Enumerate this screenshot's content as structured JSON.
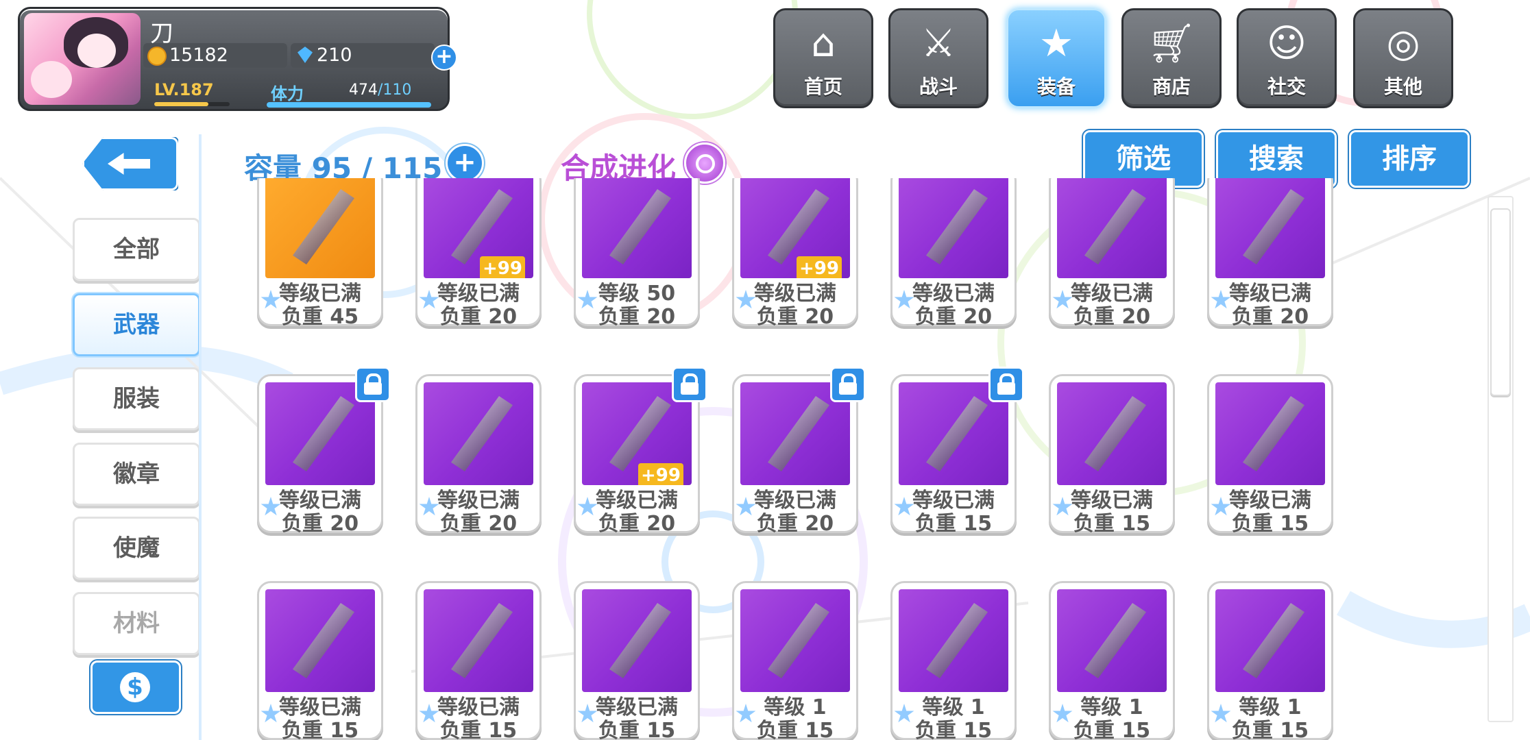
{
  "player": {
    "name": "刀",
    "coins": "15182",
    "gems": "210",
    "level": "LV.187",
    "level_progress": 0.72,
    "stamina_label": "体力",
    "stamina_current": "474",
    "stamina_max": "/110",
    "stamina_progress": 1.0
  },
  "nav": [
    {
      "label": "首页",
      "icon": "home-icon"
    },
    {
      "label": "战斗",
      "icon": "battle-icon"
    },
    {
      "label": "装备",
      "icon": "equipment-icon",
      "active": true
    },
    {
      "label": "商店",
      "icon": "shop-icon"
    },
    {
      "label": "社交",
      "icon": "social-icon"
    },
    {
      "label": "其他",
      "icon": "other-icon"
    }
  ],
  "tabs": [
    {
      "label": "全部"
    },
    {
      "label": "武器",
      "active": true
    },
    {
      "label": "服装"
    },
    {
      "label": "徽章"
    },
    {
      "label": "使魔"
    },
    {
      "label": "材料"
    }
  ],
  "capacity": "容量 95 / 115",
  "evolve": "合成进化",
  "actions": {
    "filter": "筛选",
    "search": "搜索",
    "sort": "排序"
  },
  "items": [
    {
      "level": "等级已满",
      "weight": "负重 45",
      "bg": "orange",
      "badge": "",
      "lock": false,
      "icon": "blaster-weapon-icon"
    },
    {
      "level": "等级已满",
      "weight": "负重 20",
      "bg": "purple",
      "badge": "+99",
      "lock": false,
      "icon": "sword-icon"
    },
    {
      "level": "等级 50",
      "weight": "负重 20",
      "bg": "purple",
      "badge": "",
      "lock": false,
      "icon": "sword-icon"
    },
    {
      "level": "等级已满",
      "weight": "负重 20",
      "bg": "purple",
      "badge": "+99",
      "lock": false,
      "icon": "crown-orb-icon"
    },
    {
      "level": "等级已满",
      "weight": "负重 20",
      "bg": "purple",
      "badge": "",
      "lock": false,
      "icon": "gauntlet-icon"
    },
    {
      "level": "等级已满",
      "weight": "负重 20",
      "bg": "purple",
      "badge": "",
      "lock": false,
      "icon": "lantern-icon"
    },
    {
      "level": "等级已满",
      "weight": "负重 20",
      "bg": "purple",
      "badge": "",
      "lock": false,
      "icon": "bread-icon"
    },
    {
      "level": "等级已满",
      "weight": "负重 20",
      "bg": "purple",
      "badge": "",
      "lock": true,
      "icon": "potion-bottle-icon"
    },
    {
      "level": "等级已满",
      "weight": "负重 20",
      "bg": "purple",
      "badge": "",
      "lock": false,
      "icon": "perfume-bottle-icon"
    },
    {
      "level": "等级已满",
      "weight": "负重 20",
      "bg": "purple",
      "badge": "+99",
      "lock": true,
      "icon": "axe-icon"
    },
    {
      "level": "等级已满",
      "weight": "负重 20",
      "bg": "purple",
      "badge": "",
      "lock": true,
      "icon": "lance-icon"
    },
    {
      "level": "等级已满",
      "weight": "负重 15",
      "bg": "purple",
      "badge": "",
      "lock": true,
      "icon": "dark-emblem-icon"
    },
    {
      "level": "等级已满",
      "weight": "负重 15",
      "bg": "purple",
      "badge": "",
      "lock": false,
      "icon": "dark-blade-icon"
    },
    {
      "level": "等级已满",
      "weight": "负重 15",
      "bg": "purple",
      "badge": "",
      "lock": false,
      "icon": "pistol-icon"
    },
    {
      "level": "等级已满",
      "weight": "负重 15",
      "bg": "purple",
      "badge": "",
      "lock": false,
      "icon": "rifle-icon"
    },
    {
      "level": "等级已满",
      "weight": "负重 15",
      "bg": "purple",
      "badge": "",
      "lock": false,
      "icon": "gear-staff-icon"
    },
    {
      "level": "等级已满",
      "weight": "负重 15",
      "bg": "purple",
      "badge": "",
      "lock": false,
      "icon": "gear-staff-icon"
    },
    {
      "level": "等级 1",
      "weight": "负重 15",
      "bg": "purple",
      "badge": "",
      "lock": false,
      "icon": "ornate-gun-icon"
    },
    {
      "level": "等级 1",
      "weight": "负重 15",
      "bg": "purple",
      "badge": "",
      "lock": false,
      "icon": "egg-staff-icon"
    },
    {
      "level": "等级 1",
      "weight": "负重 15",
      "bg": "purple",
      "badge": "",
      "lock": false,
      "icon": "disc-device-icon"
    },
    {
      "level": "等级 1",
      "weight": "负重 15",
      "bg": "purple",
      "badge": "",
      "lock": false,
      "icon": "scythe-icon"
    }
  ],
  "colors": {
    "accent_blue": "#3296e6",
    "item_purple": "#9a36dc",
    "item_orange": "#f5a023",
    "evolve_purple": "#b94fd6",
    "badge_yellow": "#f6b81e"
  }
}
